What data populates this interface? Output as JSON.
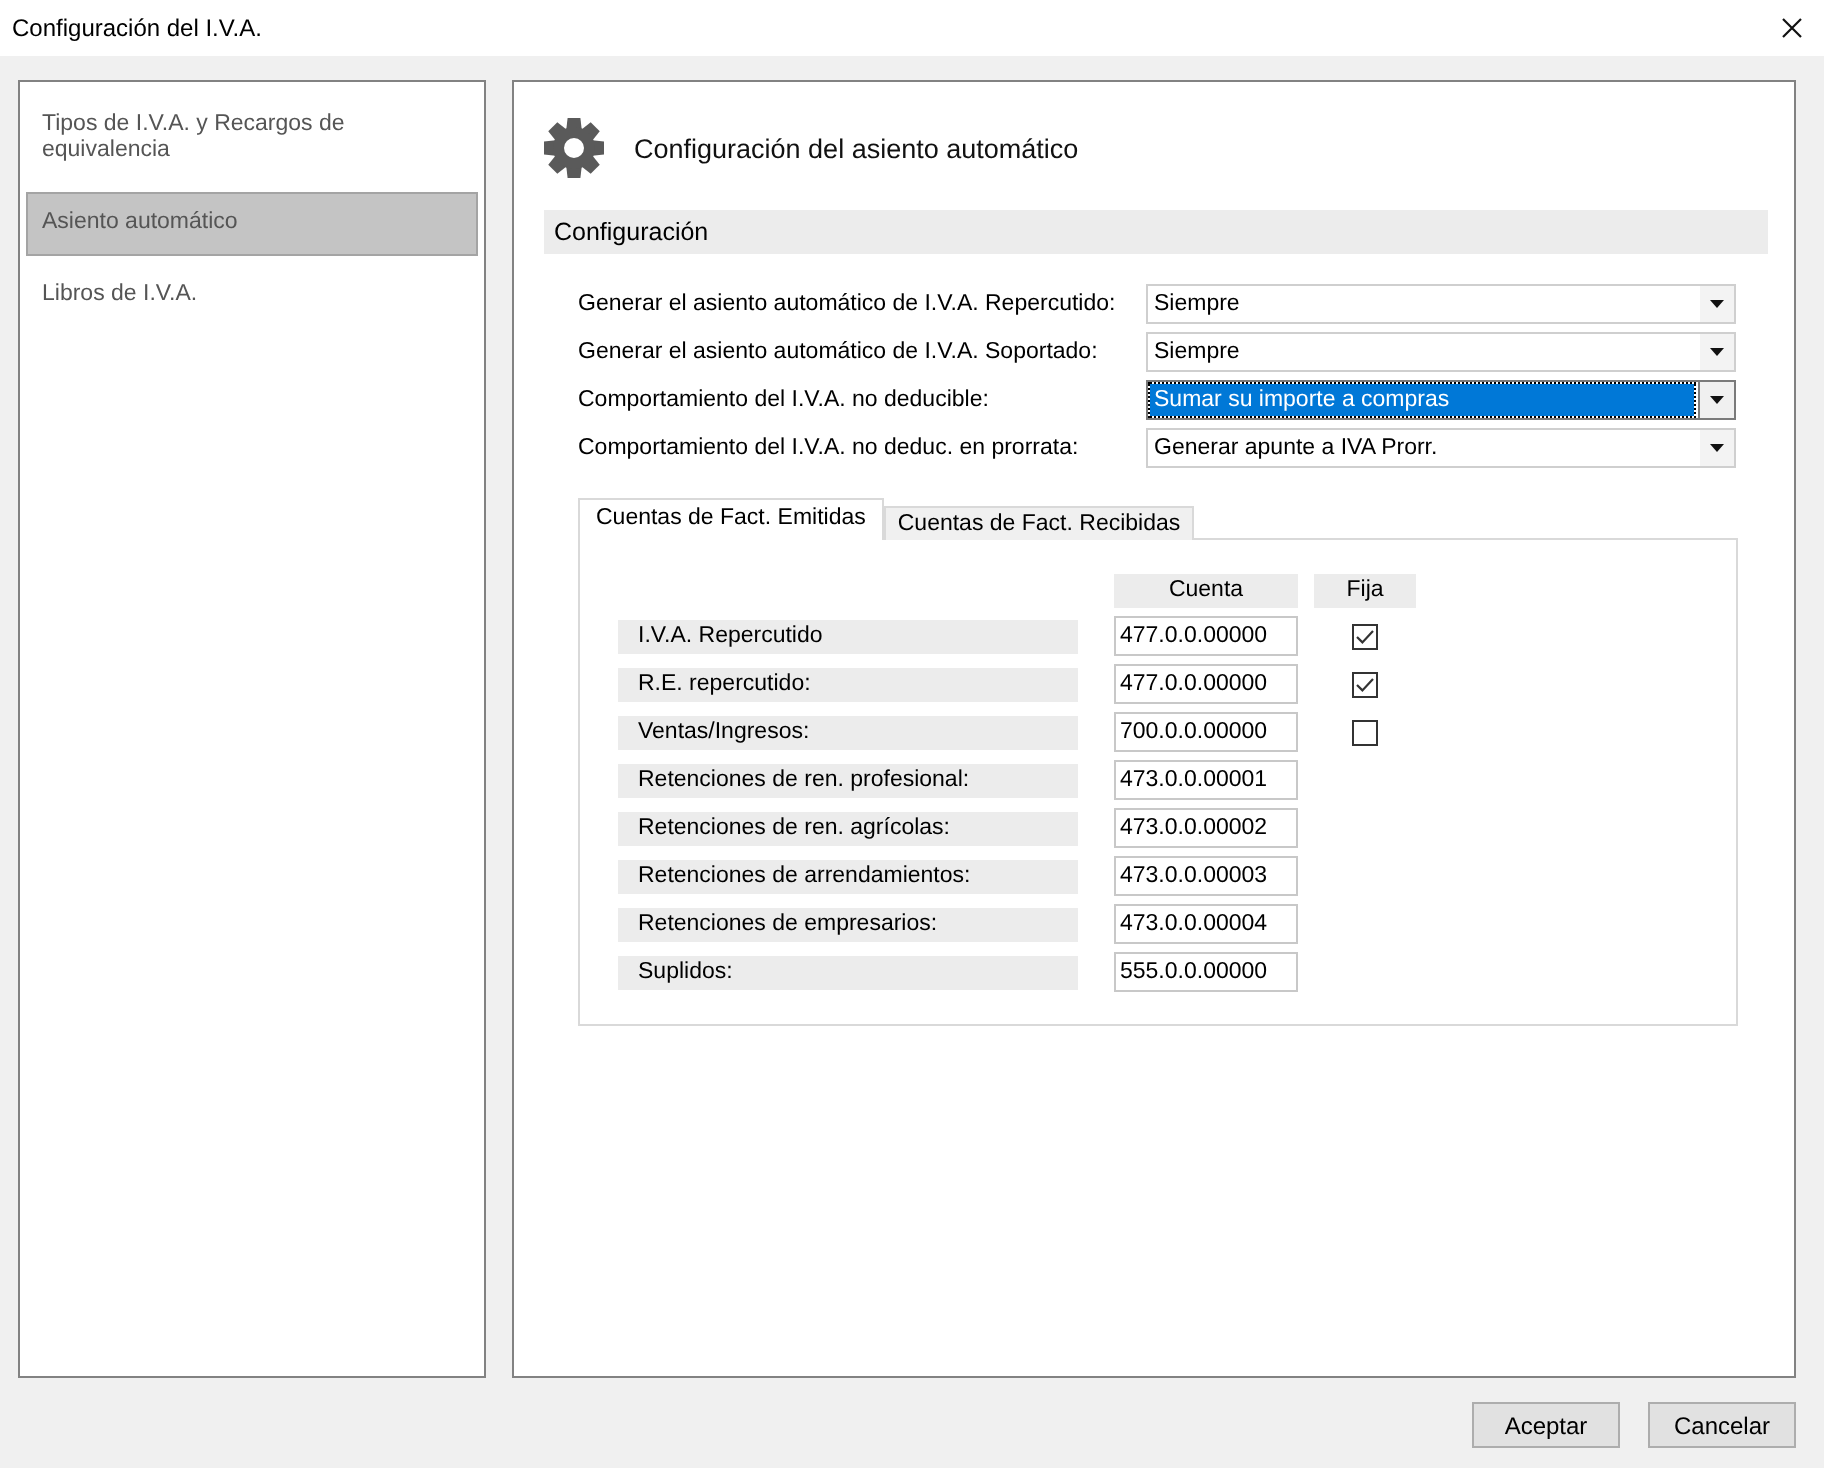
{
  "window": {
    "title": "Configuración del I.V.A."
  },
  "sidebar": {
    "items": [
      {
        "label": "Tipos de I.V.A. y Recargos de equivalencia",
        "selected": false
      },
      {
        "label": "Asiento automático",
        "selected": true
      },
      {
        "label": "Libros de I.V.A.",
        "selected": false
      }
    ]
  },
  "panel": {
    "title": "Configuración del asiento automático",
    "section": "Configuración"
  },
  "settings": [
    {
      "label": "Generar el asiento automático de I.V.A. Repercutido:",
      "value": "Siempre",
      "focused": false
    },
    {
      "label": "Generar el asiento automático de I.V.A. Soportado:",
      "value": "Siempre",
      "focused": false
    },
    {
      "label": "Comportamiento del I.V.A. no deducible:",
      "value": "Sumar su importe a compras",
      "focused": true
    },
    {
      "label": "Comportamiento del I.V.A. no deduc. en prorrata:",
      "value": "Generar apunte a IVA Prorr.",
      "focused": false
    }
  ],
  "tabs": [
    {
      "label": "Cuentas de Fact. Emitidas",
      "selected": true
    },
    {
      "label": "Cuentas de Fact. Recibidas",
      "selected": false
    }
  ],
  "accounts": {
    "columns": [
      "Cuenta",
      "Fija"
    ],
    "rows": [
      {
        "label": "I.V.A. Repercutido",
        "account": "477.0.0.00000",
        "kind": "checkbox",
        "checked": true
      },
      {
        "label": "R.E. repercutido:",
        "account": "477.0.0.00000",
        "kind": "checkbox",
        "checked": true
      },
      {
        "label": "Ventas/Ingresos:",
        "account": "700.0.0.00000",
        "kind": "checkbox",
        "checked": false
      },
      {
        "label": "Retenciones de ren. profesional:",
        "account": "473.0.0.00001",
        "kind": "plain"
      },
      {
        "label": "Retenciones de ren. agrícolas:",
        "account": "473.0.0.00002",
        "kind": "plain"
      },
      {
        "label": "Retenciones de arrendamientos:",
        "account": "473.0.0.00003",
        "kind": "plain"
      },
      {
        "label": "Retenciones de empresarios:",
        "account": "473.0.0.00004",
        "kind": "plain"
      },
      {
        "label": "Suplidos:",
        "account": "555.0.0.00000",
        "kind": "plain"
      }
    ]
  },
  "buttons": [
    {
      "label": "Aceptar"
    },
    {
      "label": "Cancelar"
    }
  ]
}
